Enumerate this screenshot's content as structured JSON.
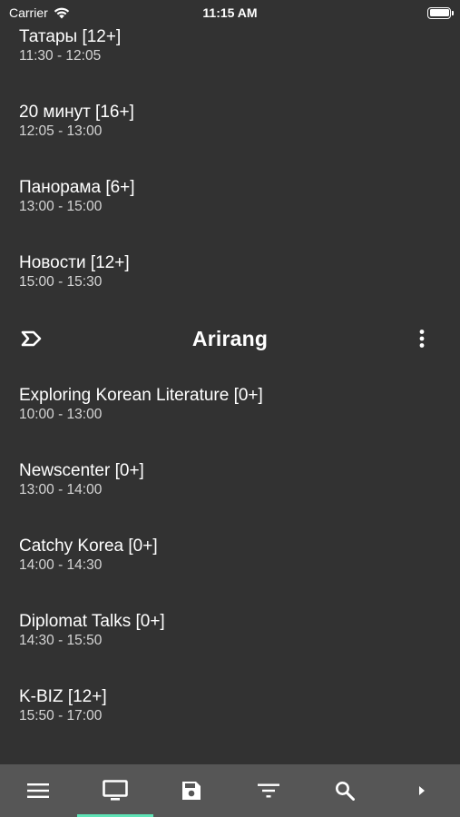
{
  "status_bar": {
    "carrier": "Carrier",
    "time": "11:15 AM"
  },
  "schedule_top": [
    {
      "title": "Татары [12+]",
      "time": "11:30 - 12:05"
    },
    {
      "title": "20 минут [16+]",
      "time": "12:05 - 13:00"
    },
    {
      "title": "Панорама [6+]",
      "time": "13:00 - 15:00"
    },
    {
      "title": "Новости [12+]",
      "time": "15:00 - 15:30"
    }
  ],
  "channel": {
    "name": "Arirang"
  },
  "schedule_channel": [
    {
      "title": "Exploring Korean Literature [0+]",
      "time": "10:00 - 13:00"
    },
    {
      "title": "Newscenter [0+]",
      "time": "13:00 - 14:00"
    },
    {
      "title": "Catchy Korea [0+]",
      "time": "14:00 - 14:30"
    },
    {
      "title": "Diplomat Talks [0+]",
      "time": "14:30 - 15:50"
    },
    {
      "title": "K-BIZ [12+]",
      "time": "15:50 - 17:00"
    }
  ],
  "bottom_nav": {
    "items": [
      "menu-icon",
      "tv-icon",
      "save-icon",
      "filter-icon",
      "search-icon",
      "play-arrow-icon"
    ],
    "active": "tv-icon",
    "accent_color": "#5fe3b6"
  },
  "colors": {
    "background": "#323232",
    "bottom_bar": "#565656",
    "text_primary": "#ffffff",
    "text_secondary": "#d6d6d6"
  }
}
